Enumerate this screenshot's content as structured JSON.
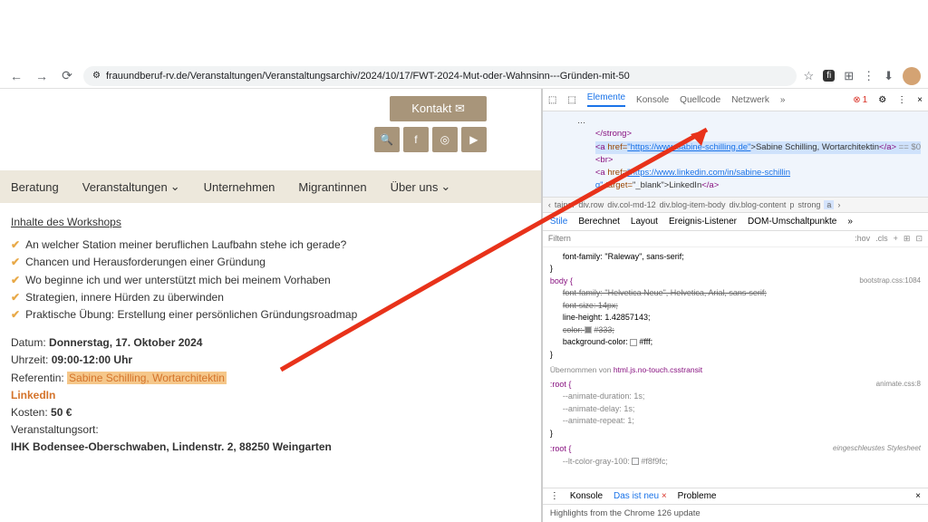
{
  "url": "frauundberuf-rv.de/Veranstaltungen/Veranstaltungsarchiv/2024/10/17/FWT-2024-Mut-oder-Wahnsinn---Gründen-mit-50",
  "header": {
    "contact": "Kontakt",
    "contact_icon": "✉"
  },
  "nav": {
    "beratung": "Beratung",
    "veranstaltungen": "Veranstaltungen",
    "unternehmen": "Unternehmen",
    "migrantinnen": "Migrantinnen",
    "uber_uns": "Über uns"
  },
  "body": {
    "workshop_title": "Inhalte des Workshops",
    "bullets": [
      "An welcher Station meiner beruflichen Laufbahn stehe ich gerade?",
      "Chancen und Herausforderungen einer Gründung",
      "Wo beginne ich und wer unterstützt mich bei meinem Vorhaben",
      "Strategien, innere Hürden zu überwinden",
      "Praktische Übung: Erstellung einer persönlichen Gründungsroadmap"
    ],
    "datum_label": "Datum:",
    "datum": "Donnerstag, 17. Oktober 2024",
    "uhrzeit_label": "Uhrzeit:",
    "uhrzeit": "09:00-12:00 Uhr",
    "referentin_label": "Referentin:",
    "referentin": "Sabine Schilling, Wortarchitektin",
    "linkedin": "LinkedIn",
    "kosten_label": "Kosten:",
    "kosten": "50 €",
    "ort_label": "Veranstaltungsort:",
    "ort": "IHK Bodensee-Oberschwaben, Lindenstr. 2, 88250 Weingarten"
  },
  "devtools": {
    "tabs": {
      "elemente": "Elemente",
      "konsole": "Konsole",
      "quellcode": "Quellcode",
      "netzwerk": "Netzwerk"
    },
    "error_count": "1",
    "html": {
      "strong_close": "</strong>",
      "a_tag": "<a",
      "href_attr": "href=",
      "url1": "\"https://www.sabine-schilling.de\"",
      "text1": ">Sabine Schilling, Wortarchitektin",
      "a_close": "</a>",
      "eq": " == $0",
      "br": "<br>",
      "url2": "\"https://www.linkedin.com/in/sabine-schillin",
      "g_target": "g\"",
      "target_attr": "target=",
      "target_val": "\"_blank\"",
      "text2": ">LinkedIn"
    },
    "breadcrumb": [
      "tainer",
      "div.row",
      "div.col-md-12",
      "div.blog-item-body",
      "div.blog-content",
      "p",
      "strong",
      "a"
    ],
    "styles_tabs": {
      "stile": "Stile",
      "berechnet": "Berechnet",
      "layout": "Layout",
      "ereignis": "Ereignis-Listener",
      "dom": "DOM-Umschaltpunkte"
    },
    "filter": "Filtern",
    "hov": ":hov",
    "cls": ".cls",
    "css": {
      "font_family": "font-family: \"Raleway\", sans-serif;",
      "body": "body {",
      "body_link": "bootstrap.css:1084",
      "ff_strike": "font-family: \"Helvetica Neue\", Helvetica, Arial, sans-serif;",
      "fs_strike": "font-size: 14px;",
      "lh": "line-height: 1.42857143;",
      "color_strike": "color: ",
      "color_val": "#333;",
      "bg": "background-color: ",
      "bg_val": "#fff;",
      "inherit_from": "Übernommen von",
      "inherit_el": "html.js.no-touch.csstransit",
      "root": ":root {",
      "root_link": "animate.css:8",
      "anim_dur": "--animate-duration: 1s;",
      "anim_delay": "--animate-delay: 1s;",
      "anim_repeat": "--animate-repeat: 1;",
      "root2_link": "eingeschleustes Stylesheet",
      "lt_gray": "--lt-color-gray-100: ",
      "lt_gray_val": "#f8f9fc;"
    },
    "bottom_tabs": {
      "konsole": "Konsole",
      "neu": "Das ist neu",
      "probleme": "Probleme"
    },
    "new_badge": "×",
    "bottom_msg": "Highlights from the Chrome 126 update"
  }
}
